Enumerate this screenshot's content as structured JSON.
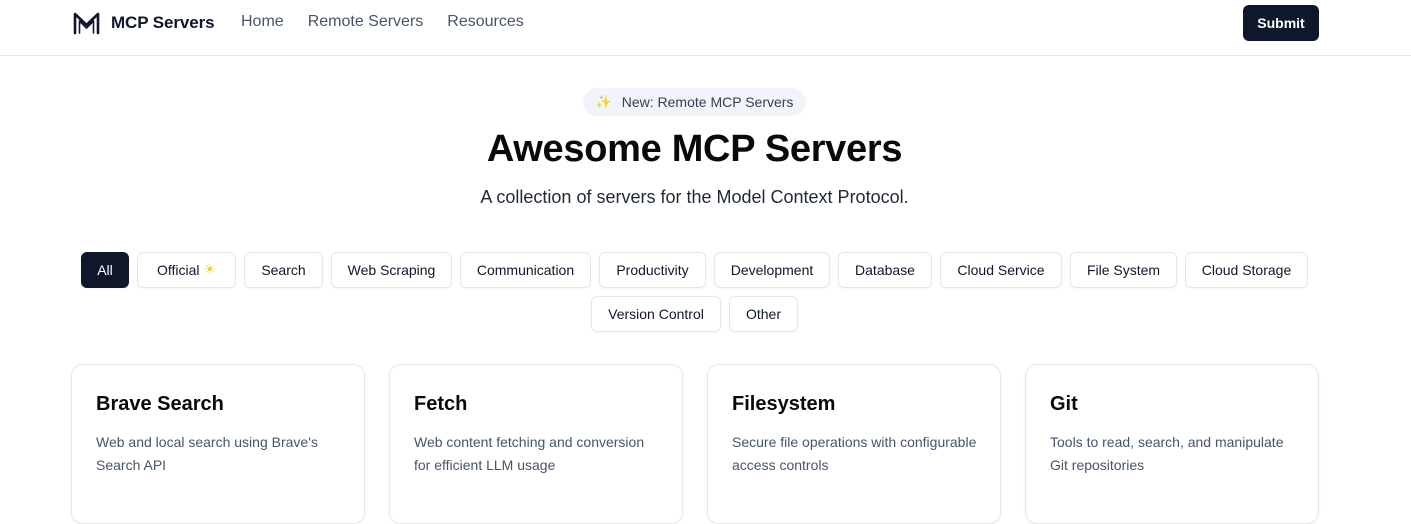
{
  "header": {
    "brand": "MCP Servers",
    "logo_icon": "m-logo-icon",
    "nav": [
      "Home",
      "Remote Servers",
      "Resources"
    ],
    "submit_label": "Submit"
  },
  "hero": {
    "announcement": "New: Remote MCP Servers",
    "announcement_icon": "sparkles-icon",
    "title": "Awesome MCP Servers",
    "subtitle": "A collection of servers for the Model Context Protocol."
  },
  "filters": {
    "selected": "All",
    "items": [
      "All",
      "Official",
      "Search",
      "Web Scraping",
      "Communication",
      "Productivity",
      "Development",
      "Database",
      "Cloud Service",
      "File System",
      "Cloud Storage",
      "Version Control",
      "Other"
    ],
    "official_icon": "sun-icon"
  },
  "servers": [
    {
      "name": "Brave Search",
      "description": "Web and local search using Brave's Search API"
    },
    {
      "name": "Fetch",
      "description": "Web content fetching and conversion for efficient LLM usage"
    },
    {
      "name": "Filesystem",
      "description": "Secure file operations with configurable access controls"
    },
    {
      "name": "Git",
      "description": "Tools to read, search, and manipulate Git repositories"
    }
  ],
  "colors": {
    "primary": "#0f172a",
    "muted_text": "#475569",
    "border": "#e5e7eb",
    "announcement_bg": "#f1f5f9",
    "accent_sun": "#facc15"
  }
}
